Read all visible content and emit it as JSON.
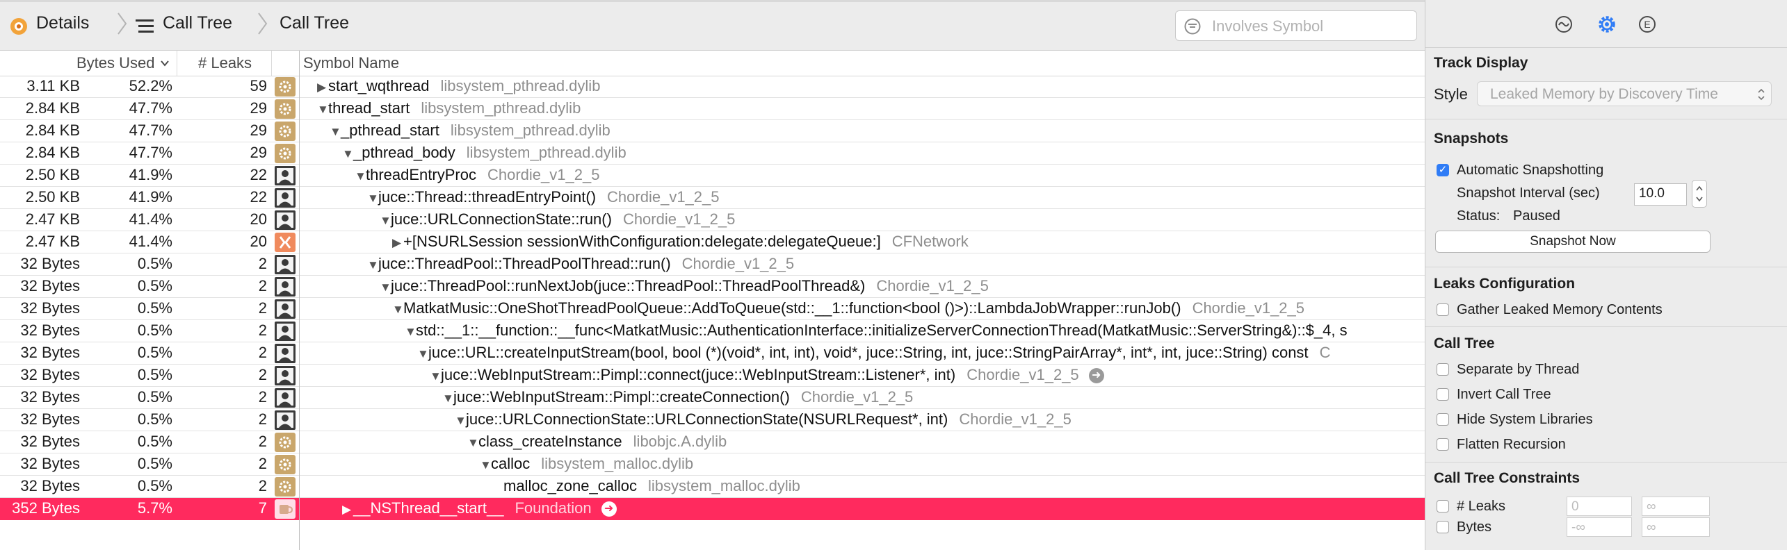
{
  "breadcrumb": {
    "items": [
      {
        "label": "Details",
        "icon": "instrument-icon"
      },
      {
        "label": "Call Tree",
        "icon": "call-tree-icon"
      },
      {
        "label": "Call Tree",
        "icon": ""
      }
    ]
  },
  "search": {
    "placeholder": "Involves Symbol"
  },
  "columns": {
    "bytes_used": "Bytes Used",
    "leaks": "# Leaks",
    "symbol_name": "Symbol Name"
  },
  "rows": [
    {
      "bytes": "3.11 KB",
      "pct": "52.2%",
      "leaks": "59",
      "icon": "gear",
      "depth": 0,
      "tri": "right",
      "symbol": "start_wqthread",
      "library": "libsystem_pthread.dylib"
    },
    {
      "bytes": "2.84 KB",
      "pct": "47.7%",
      "leaks": "29",
      "icon": "gear",
      "depth": 0,
      "tri": "down",
      "symbol": "thread_start",
      "library": "libsystem_pthread.dylib"
    },
    {
      "bytes": "2.84 KB",
      "pct": "47.7%",
      "leaks": "29",
      "icon": "gear",
      "depth": 1,
      "tri": "down",
      "symbol": "_pthread_start",
      "library": "libsystem_pthread.dylib"
    },
    {
      "bytes": "2.84 KB",
      "pct": "47.7%",
      "leaks": "29",
      "icon": "gear",
      "depth": 2,
      "tri": "down",
      "symbol": "_pthread_body",
      "library": "libsystem_pthread.dylib"
    },
    {
      "bytes": "2.50 KB",
      "pct": "41.9%",
      "leaks": "22",
      "icon": "user",
      "depth": 3,
      "tri": "down",
      "symbol": "threadEntryProc",
      "library": "Chordie_v1_2_5"
    },
    {
      "bytes": "2.50 KB",
      "pct": "41.9%",
      "leaks": "22",
      "icon": "user",
      "depth": 4,
      "tri": "down",
      "symbol": "juce::Thread::threadEntryPoint()",
      "library": "Chordie_v1_2_5"
    },
    {
      "bytes": "2.47 KB",
      "pct": "41.4%",
      "leaks": "20",
      "icon": "user",
      "depth": 5,
      "tri": "down",
      "symbol": "juce::URLConnectionState::run()",
      "library": "Chordie_v1_2_5"
    },
    {
      "bytes": "2.47 KB",
      "pct": "41.4%",
      "leaks": "20",
      "icon": "orange",
      "depth": 6,
      "tri": "right",
      "symbol": "+[NSURLSession sessionWithConfiguration:delegate:delegateQueue:]",
      "library": "CFNetwork"
    },
    {
      "bytes": "32 Bytes",
      "pct": "0.5%",
      "leaks": "2",
      "icon": "user",
      "depth": 4,
      "tri": "down",
      "symbol": "juce::ThreadPool::ThreadPoolThread::run()",
      "library": "Chordie_v1_2_5"
    },
    {
      "bytes": "32 Bytes",
      "pct": "0.5%",
      "leaks": "2",
      "icon": "user",
      "depth": 5,
      "tri": "down",
      "symbol": "juce::ThreadPool::runNextJob(juce::ThreadPool::ThreadPoolThread&)",
      "library": "Chordie_v1_2_5"
    },
    {
      "bytes": "32 Bytes",
      "pct": "0.5%",
      "leaks": "2",
      "icon": "user",
      "depth": 6,
      "tri": "down",
      "symbol": "MatkatMusic::OneShotThreadPoolQueue::AddToQueue(std::__1::function<bool ()>)::LambdaJobWrapper::runJob()",
      "library": "Chordie_v1_2_5"
    },
    {
      "bytes": "32 Bytes",
      "pct": "0.5%",
      "leaks": "2",
      "icon": "user",
      "depth": 7,
      "tri": "down",
      "symbol": "std::__1::__function::__func<MatkatMusic::AuthenticationInterface::initializeServerConnectionThread(MatkatMusic::ServerString&)::$_4, s",
      "library": ""
    },
    {
      "bytes": "32 Bytes",
      "pct": "0.5%",
      "leaks": "2",
      "icon": "user",
      "depth": 8,
      "tri": "down",
      "symbol": "juce::URL::createInputStream(bool, bool (*)(void*, int, int), void*, juce::String, int, juce::StringPairArray*, int*, int, juce::String) const",
      "library": "C"
    },
    {
      "bytes": "32 Bytes",
      "pct": "0.5%",
      "leaks": "2",
      "icon": "user",
      "depth": 9,
      "tri": "down",
      "symbol": "juce::WebInputStream::Pimpl::connect(juce::WebInputStream::Listener*, int)",
      "library": "Chordie_v1_2_5",
      "go": true
    },
    {
      "bytes": "32 Bytes",
      "pct": "0.5%",
      "leaks": "2",
      "icon": "user",
      "depth": 10,
      "tri": "down",
      "symbol": "juce::WebInputStream::Pimpl::createConnection()",
      "library": "Chordie_v1_2_5"
    },
    {
      "bytes": "32 Bytes",
      "pct": "0.5%",
      "leaks": "2",
      "icon": "user",
      "depth": 11,
      "tri": "down",
      "symbol": "juce::URLConnectionState::URLConnectionState(NSURLRequest*, int)",
      "library": "Chordie_v1_2_5"
    },
    {
      "bytes": "32 Bytes",
      "pct": "0.5%",
      "leaks": "2",
      "icon": "gear",
      "depth": 12,
      "tri": "down",
      "symbol": "class_createInstance",
      "library": "libobjc.A.dylib"
    },
    {
      "bytes": "32 Bytes",
      "pct": "0.5%",
      "leaks": "2",
      "icon": "gear",
      "depth": 13,
      "tri": "down",
      "symbol": "calloc",
      "library": "libsystem_malloc.dylib"
    },
    {
      "bytes": "32 Bytes",
      "pct": "0.5%",
      "leaks": "2",
      "icon": "gear",
      "depth": 14,
      "tri": "none",
      "symbol": "malloc_zone_calloc",
      "library": "libsystem_malloc.dylib"
    },
    {
      "bytes": "352 Bytes",
      "pct": "5.7%",
      "leaks": "7",
      "icon": "coffee",
      "depth": 2,
      "tri": "right",
      "symbol": "__NSThread__start__",
      "library": "Foundation",
      "selected": true,
      "go": true
    }
  ],
  "inspector": {
    "tabs": [
      {
        "name": "tab-record-settings",
        "icon": "clock-icon"
      },
      {
        "name": "tab-display-settings",
        "icon": "gear-icon",
        "active": true
      },
      {
        "name": "tab-extended-detail",
        "icon": "e-circle-icon"
      }
    ],
    "track_display": {
      "title": "Track Display",
      "style_label": "Style",
      "style_value": "Leaked Memory by Discovery Time"
    },
    "snapshots": {
      "title": "Snapshots",
      "auto_label": "Automatic Snapshotting",
      "auto_checked": true,
      "interval_label": "Snapshot Interval (sec)",
      "interval_value": "10.0",
      "status_label": "Status:",
      "status_value": "Paused",
      "button": "Snapshot Now"
    },
    "leaks_config": {
      "title": "Leaks Configuration",
      "gather_label": "Gather Leaked Memory Contents"
    },
    "call_tree": {
      "title": "Call Tree",
      "options": [
        "Separate by Thread",
        "Invert Call Tree",
        "Hide System Libraries",
        "Flatten Recursion"
      ]
    },
    "constraints": {
      "title": "Call Tree Constraints",
      "leaks_label": "# Leaks",
      "bytes_label": "Bytes",
      "leaks_min": "0",
      "leaks_max": "∞",
      "bytes_min": "-∞",
      "bytes_max": "∞"
    }
  },
  "colors": {
    "selection": "#ff2a5e",
    "accent": "#2f7cf6",
    "gear_icon": "#c9a66b",
    "orange_icon": "#f08a5d"
  }
}
